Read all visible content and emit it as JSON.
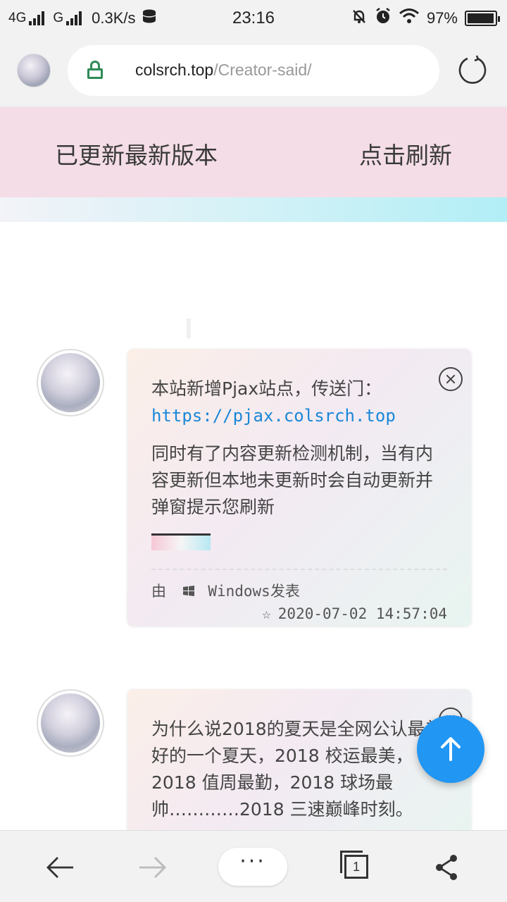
{
  "status_bar": {
    "network1": "4G",
    "network2": "G",
    "speed": "0.3K/s",
    "time": "23:16",
    "battery": "97%"
  },
  "browser": {
    "url_domain": "colsrch.top",
    "url_path": "/Creator-said/"
  },
  "banner": {
    "message": "已更新最新版本",
    "refresh_label": "点击刷新"
  },
  "posts": [
    {
      "text1": "本站新增Pjax站点，传送门：",
      "link": "https://pjax.colsrch.top",
      "text2": "同时有了内容更新检测机制，当有内容更新但本地未更新时会自动更新并弹窗提示您刷新",
      "author_prefix": "由",
      "author": "Windows发表",
      "timestamp": "2020-07-02 14:57:04"
    },
    {
      "text1": "为什么说2018的夏天是全网公认最美好的一个夏天，2018 校运最美，2018 值周最勤，2018 球场最帅…………2018 三速巅峰时刻。"
    }
  ],
  "bottom_nav": {
    "menu_label": "···",
    "tab_count": "1"
  }
}
